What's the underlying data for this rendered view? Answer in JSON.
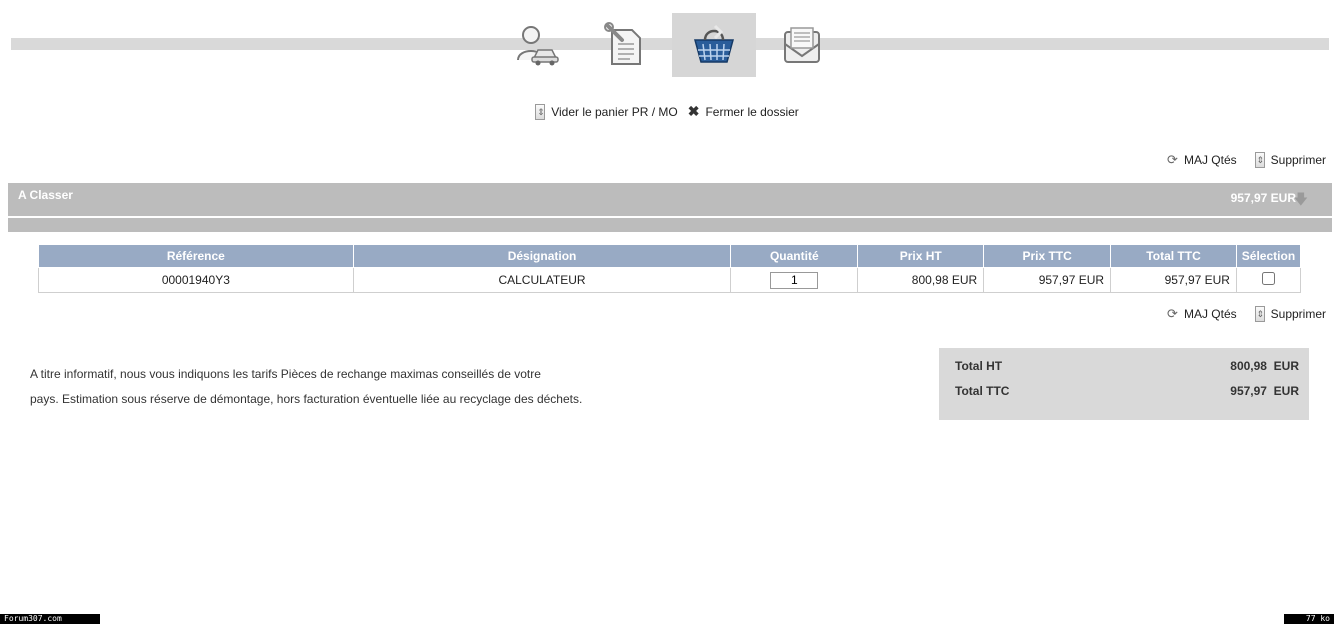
{
  "steps": [
    {
      "name": "client-vehicle",
      "active": false
    },
    {
      "name": "documents",
      "active": false
    },
    {
      "name": "cart",
      "active": true
    },
    {
      "name": "mail",
      "active": false
    }
  ],
  "actions_top": {
    "empty_cart": "Vider le panier PR / MO",
    "close_folder": "Fermer le dossier"
  },
  "toolbar": {
    "update_qty": "MAJ Qtés",
    "delete": "Supprimer"
  },
  "group": {
    "title": "A Classer",
    "total": "957,97 EUR"
  },
  "table": {
    "headers": [
      "Référence",
      "Désignation",
      "Quantité",
      "Prix HT",
      "Prix TTC",
      "Total TTC",
      "Sélection"
    ],
    "rows": [
      {
        "reference": "00001940Y3",
        "designation": "CALCULATEUR",
        "quantity": "1",
        "price_ht": "800,98 EUR",
        "price_ttc": "957,97 EUR",
        "total_ttc": "957,97 EUR",
        "selected": false
      }
    ]
  },
  "info": {
    "line1": "A titre informatif, nous vous indiquons les tarifs Pièces de rechange maximas conseillés de votre",
    "line2": "pays. Estimation sous réserve de démontage, hors facturation éventuelle liée au recyclage des déchets."
  },
  "totals": {
    "ht_label": "Total HT",
    "ht_value": "800,98",
    "ht_currency": "EUR",
    "ttc_label": "Total TTC",
    "ttc_value": "957,97",
    "ttc_currency": "EUR"
  },
  "footer": {
    "left": "Forum307.com",
    "right": "77 ko"
  }
}
